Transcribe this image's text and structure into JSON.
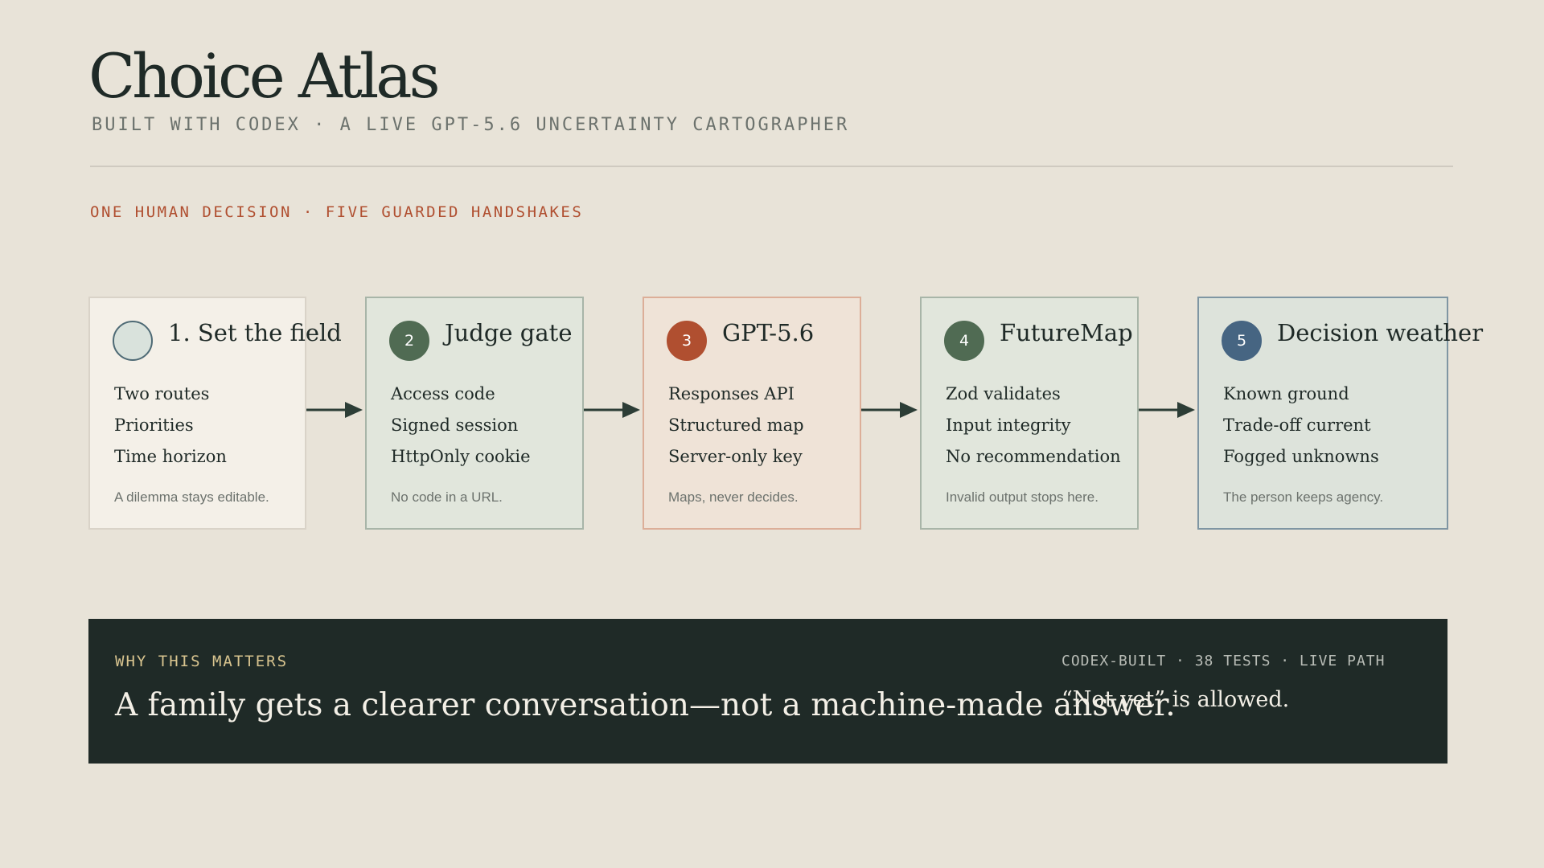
{
  "header": {
    "title": "Choice Atlas",
    "subtitle": "BUILT WITH CODEX · A LIVE GPT-5.6 UNCERTAINTY CARTOGRAPHER"
  },
  "section_label": "ONE HUMAN DECISION · FIVE GUARDED HANDSHAKES",
  "steps": [
    {
      "badge": "",
      "title": "1. Set the field",
      "items": [
        "Two routes",
        "Priorities",
        "Time horizon"
      ],
      "note": "A dilemma stays editable.",
      "fill": "#f4f0e8",
      "border": "#d9d3c8",
      "badge_fill": "#d9e2dc",
      "badge_border": "#4e6a75"
    },
    {
      "badge": "2",
      "title": "Judge gate",
      "items": [
        "Access code",
        "Signed session",
        "HttpOnly cookie"
      ],
      "note": "No code in a URL.",
      "fill": "#e1e6dc",
      "border": "#a8b5a8",
      "badge_fill": "#506b53",
      "badge_border": "#506b53"
    },
    {
      "badge": "3",
      "title": "GPT-5.6",
      "items": [
        "Responses API",
        "Structured map",
        "Server-only key"
      ],
      "note": "Maps, never decides.",
      "fill": "#efe3d7",
      "border": "#dcae98",
      "badge_fill": "#b04f30",
      "badge_border": "#b04f30"
    },
    {
      "badge": "4",
      "title": "FutureMap",
      "items": [
        "Zod validates",
        "Input integrity",
        "No recommendation"
      ],
      "note": "Invalid output stops here.",
      "fill": "#e1e6dc",
      "border": "#a8b5a8",
      "badge_fill": "#506b53",
      "badge_border": "#506b53"
    },
    {
      "badge": "5",
      "title": "Decision weather",
      "items": [
        "Known ground",
        "Trade-off current",
        "Fogged unknowns"
      ],
      "note": "The person keeps agency.",
      "fill": "#dde3db",
      "border": "#7f96a3",
      "badge_fill": "#466582",
      "badge_border": "#466582"
    }
  ],
  "banner": {
    "label": "WHY THIS MATTERS",
    "headline": "A family gets a clearer conversation—not a machine-made answer.",
    "meta": "CODEX-BUILT · 38 TESTS · LIVE PATH",
    "quote": "“Not yet” is allowed."
  },
  "colors": {
    "background": "#e8e3d8",
    "ink": "#1f2a27",
    "accent": "#b04f30",
    "banner": "#1f2a27",
    "banner_label": "#d8c48f"
  }
}
